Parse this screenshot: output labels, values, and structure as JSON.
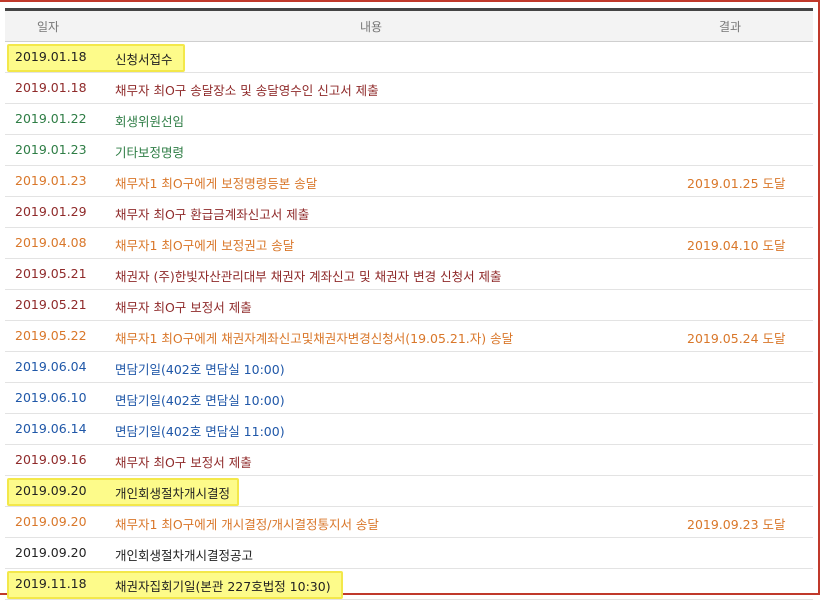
{
  "header": {
    "date_label": "일자",
    "content_label": "내용",
    "result_label": "결과"
  },
  "rows": [
    {
      "date": "2019.01.18",
      "content": "신청서접수",
      "result": "",
      "color": "#222222",
      "highlight": true
    },
    {
      "date": "2019.01.18",
      "content": "채무자 최O구 송달장소 및 송달영수인 신고서 제출",
      "result": "",
      "color": "#8f2a2a",
      "highlight": false
    },
    {
      "date": "2019.01.22",
      "content": "회생위원선임",
      "result": "",
      "color": "#2e7d45",
      "highlight": false
    },
    {
      "date": "2019.01.23",
      "content": "기타보정명령",
      "result": "",
      "color": "#2e7d45",
      "highlight": false
    },
    {
      "date": "2019.01.23",
      "content": "채무자1 최O구에게 보정명령등본 송달",
      "result": "2019.01.25 도달",
      "color": "#d9772a",
      "highlight": false
    },
    {
      "date": "2019.01.29",
      "content": "채무자 최O구 환급금계좌신고서 제출",
      "result": "",
      "color": "#8f2a2a",
      "highlight": false
    },
    {
      "date": "2019.04.08",
      "content": "채무자1 최O구에게 보정권고 송달",
      "result": "2019.04.10 도달",
      "color": "#d9772a",
      "highlight": false
    },
    {
      "date": "2019.05.21",
      "content": "채권자 (주)한빛자산관리대부 채권자 계좌신고 및 채권자 변경 신청서 제출",
      "result": "",
      "color": "#8f2a2a",
      "highlight": false
    },
    {
      "date": "2019.05.21",
      "content": "채무자 최O구 보정서 제출",
      "result": "",
      "color": "#8f2a2a",
      "highlight": false
    },
    {
      "date": "2019.05.22",
      "content": "채무자1 최O구에게 채권자계좌신고및채권자변경신청서(19.05.21.자) 송달",
      "result": "2019.05.24 도달",
      "color": "#d9772a",
      "highlight": false
    },
    {
      "date": "2019.06.04",
      "content": "면담기일(402호 면담실 10:00)",
      "result": "",
      "color": "#1f57a8",
      "highlight": false
    },
    {
      "date": "2019.06.10",
      "content": "면담기일(402호 면담실 10:00)",
      "result": "",
      "color": "#1f57a8",
      "highlight": false
    },
    {
      "date": "2019.06.14",
      "content": "면담기일(402호 면담실 11:00)",
      "result": "",
      "color": "#1f57a8",
      "highlight": false
    },
    {
      "date": "2019.09.16",
      "content": "채무자 최O구 보정서 제출",
      "result": "",
      "color": "#8f2a2a",
      "highlight": false
    },
    {
      "date": "2019.09.20",
      "content": "개인회생절차개시결정",
      "result": "",
      "color": "#222222",
      "highlight": true
    },
    {
      "date": "2019.09.20",
      "content": "채무자1 최O구에게 개시결정/개시결정통지서 송달",
      "result": "2019.09.23 도달",
      "color": "#d9772a",
      "highlight": false
    },
    {
      "date": "2019.09.20",
      "content": "개인회생절차개시결정공고",
      "result": "",
      "color": "#222222",
      "highlight": false
    },
    {
      "date": "2019.11.18",
      "content": "채권자집회기일(본관 227호법정 10:30)",
      "result": "",
      "color": "#222222",
      "highlight": true
    }
  ]
}
